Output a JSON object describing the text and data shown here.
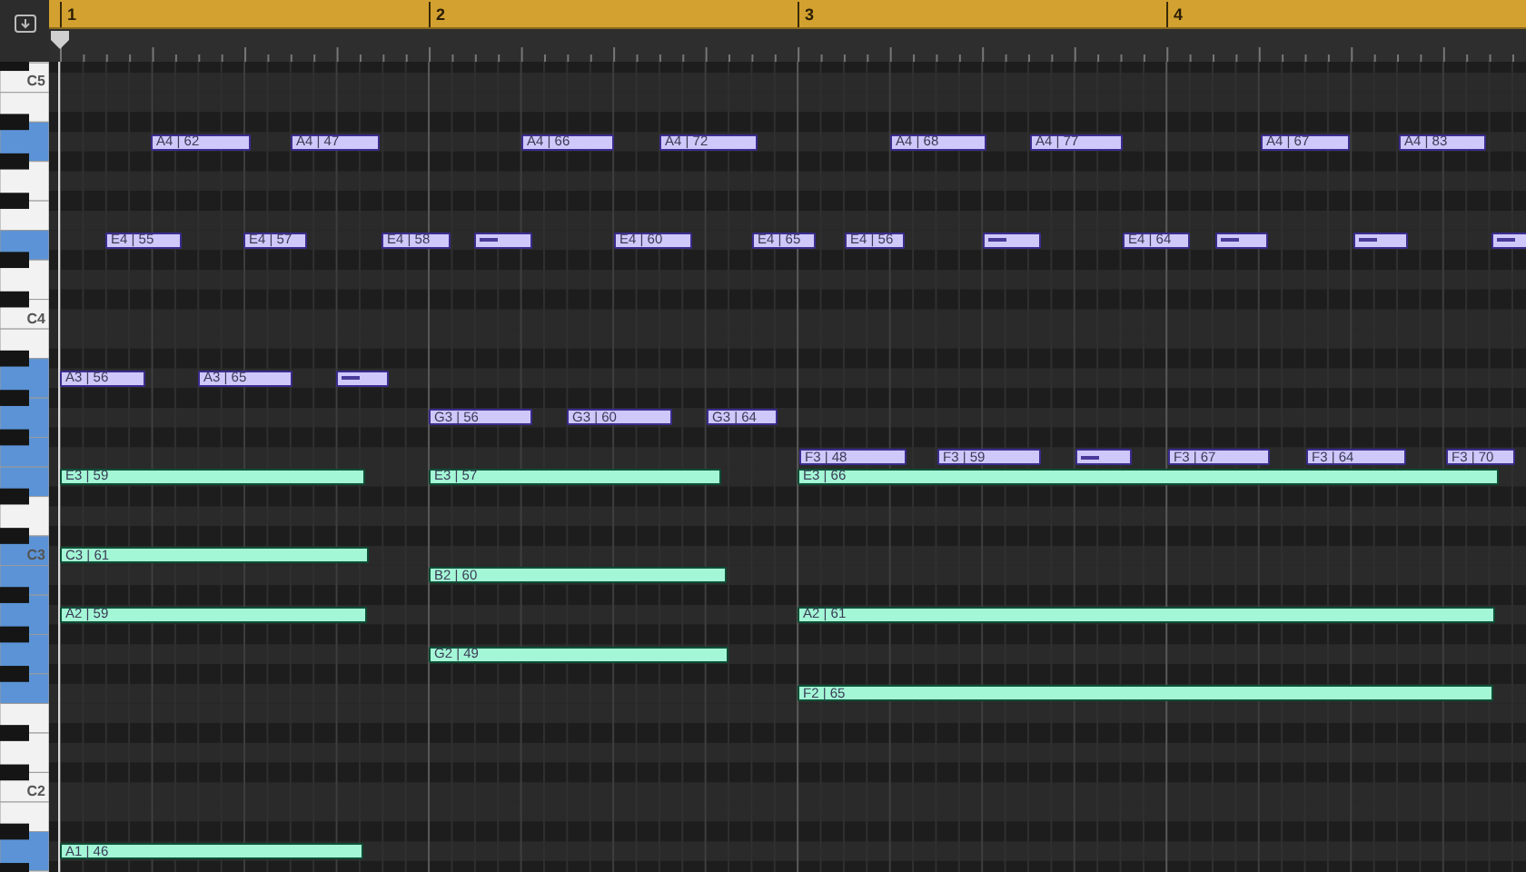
{
  "ruler": {
    "bars": [
      "1",
      "2",
      "3",
      "4"
    ]
  },
  "keyboard": {
    "octave_labels": [
      "C5",
      "C4",
      "C3",
      "C2"
    ]
  },
  "notes": [
    {
      "kind": "labeled",
      "label": "A4 | 62",
      "color": "#cfc8fb"
    },
    {
      "kind": "labeled",
      "label": "A4 | 47",
      "color": "#cfc8fb"
    },
    {
      "kind": "labeled",
      "label": "A4 | 66",
      "color": "#cfc8fb"
    },
    {
      "kind": "labeled",
      "label": "A4 | 72",
      "color": "#cfc8fb"
    },
    {
      "kind": "labeled",
      "label": "A4 | 68",
      "color": "#cfc8fb"
    },
    {
      "kind": "labeled",
      "label": "A4 | 77",
      "color": "#cfc8fb"
    },
    {
      "kind": "labeled",
      "label": "A4 | 67",
      "color": "#cfc8fb"
    },
    {
      "kind": "labeled",
      "label": "A4 | 83",
      "color": "#cfc8fb"
    },
    {
      "kind": "labeled",
      "label": "E4 | 55",
      "color": "#cfc8fb"
    },
    {
      "kind": "labeled",
      "label": "E4 | 57",
      "color": "#cfc8fb"
    },
    {
      "kind": "labeled",
      "label": "E4 | 58",
      "color": "#cfc8fb"
    },
    {
      "kind": "short",
      "color": "#cfc8fb"
    },
    {
      "kind": "labeled",
      "label": "E4 | 60",
      "color": "#cfc8fb"
    },
    {
      "kind": "labeled",
      "label": "E4 | 65",
      "color": "#cfc8fb"
    },
    {
      "kind": "labeled",
      "label": "E4 | 56",
      "color": "#cfc8fb"
    },
    {
      "kind": "short",
      "color": "#cfc8fb"
    },
    {
      "kind": "labeled",
      "label": "E4 | 64",
      "color": "#cfc8fb"
    },
    {
      "kind": "short",
      "color": "#cfc8fb"
    },
    {
      "kind": "short",
      "color": "#cfc8fb"
    },
    {
      "kind": "short",
      "color": "#cfc8fb"
    },
    {
      "kind": "labeled",
      "label": "A3 | 56",
      "color": "#cfc8fb"
    },
    {
      "kind": "labeled",
      "label": "A3 | 65",
      "color": "#cfc8fb"
    },
    {
      "kind": "short",
      "color": "#cfc8fb"
    },
    {
      "kind": "labeled",
      "label": "G3 | 56",
      "color": "#cfc8fb"
    },
    {
      "kind": "labeled",
      "label": "G3 | 60",
      "color": "#cfc8fb"
    },
    {
      "kind": "labeled",
      "label": "G3 | 64",
      "color": "#cfc8fb"
    },
    {
      "kind": "labeled",
      "label": "F3 | 48",
      "color": "#cfc8fb"
    },
    {
      "kind": "labeled",
      "label": "F3 | 59",
      "color": "#cfc8fb"
    },
    {
      "kind": "short",
      "color": "#cfc8fb"
    },
    {
      "kind": "labeled",
      "label": "F3 | 67",
      "color": "#cfc8fb"
    },
    {
      "kind": "labeled",
      "label": "F3 | 64",
      "color": "#cfc8fb"
    },
    {
      "kind": "labeled",
      "label": "F3 | 70",
      "color": "#cfc8fb"
    },
    {
      "kind": "labeled",
      "label": "E3 | 59",
      "color": "#a4f7d6"
    },
    {
      "kind": "labeled",
      "label": "E3 | 57",
      "color": "#a4f7d6"
    },
    {
      "kind": "labeled",
      "label": "E3 | 66",
      "color": "#a4f7d6"
    },
    {
      "kind": "labeled",
      "label": "C3 | 61",
      "color": "#a4f7d6"
    },
    {
      "kind": "labeled",
      "label": "B2 | 60",
      "color": "#a4f7d6"
    },
    {
      "kind": "labeled",
      "label": "A2 | 59",
      "color": "#a4f7d6"
    },
    {
      "kind": "labeled",
      "label": "A2 | 61",
      "color": "#a4f7d6"
    },
    {
      "kind": "labeled",
      "label": "G2 | 49",
      "color": "#a4f7d6"
    },
    {
      "kind": "labeled",
      "label": "F2 | 65",
      "color": "#a4f7d6"
    },
    {
      "kind": "labeled",
      "label": "A1 | 46",
      "color": "#a4f7d6"
    }
  ]
}
